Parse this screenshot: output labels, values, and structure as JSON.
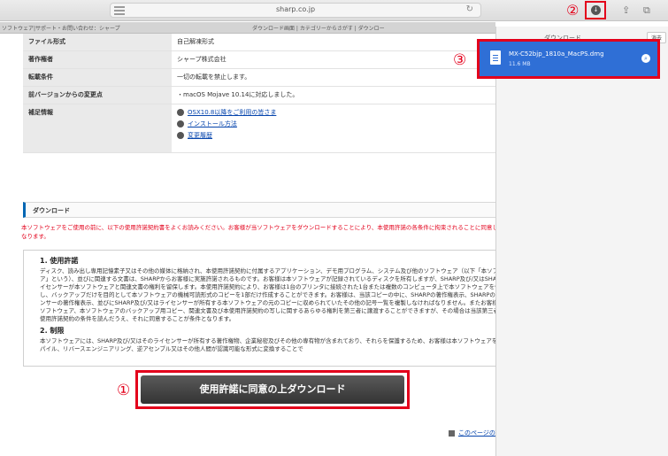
{
  "browser": {
    "address": "sharp.co.jp",
    "tab_left": "ソフトウェア|サポート・お問い合わせ：シャープ",
    "tab_right": "ダウンロード画面 | カテゴリーからさがす | ダウンロー",
    "reload_glyph": "↻",
    "share_glyph": "⇪",
    "tabs_glyph": "⧉"
  },
  "markers": {
    "one": "①",
    "two": "②",
    "three": "③"
  },
  "info": {
    "rows": [
      {
        "label": "ファイル形式",
        "value": "自己解凍形式"
      },
      {
        "label": "著作権者",
        "value": "シャープ株式会社"
      },
      {
        "label": "転載条件",
        "value": "一切の転載を禁止します。"
      },
      {
        "label": "前バージョンからの変更点",
        "value": "・macOS Mojave 10.14に対応しました。"
      }
    ],
    "supplement_label": "補足情報",
    "supplement_links": [
      "OSX10.8以降をご利用の皆さま",
      "インストール方法",
      "変更履歴"
    ]
  },
  "download_section": {
    "heading": "ダウンロード",
    "warning": "本ソフトウェアをご使用の前に、以下の使用許諾契約書をよくお読みください。お客様が当ソフトウェアをダウンロードすることにより、本使用許諾の各条件に拘束されることに同意したことになります。"
  },
  "license": {
    "h1": "1. 使用許諾",
    "p1": "ディスク、読み出し専用記憶素子又はその他の媒体に格納され、本使用許諾契約に付属するアプリケーション、デモ用プログラム、システム及び他のソフトウェア（以下「本ソフトウェア」という）、並びに関連する文書は、SHARPからお客様に実施許諾されるものです。お客様は本ソフトウェアが記録されているディスクを所有しますが、SHARP及び/又はSHARPのライセンサーが本ソフトウェアと関連文書の権利を留保します。本使用許諾契約により、お客様は1台のプリンタに接続された1台または複数のコンピュータ上で本ソフトウェアを使用し、バックアップだけを目的として本ソフトウェアの機械可読形式のコピーを1部だけ作成することができます。お客様は、当該コピーの中に、SHARPの著作権表示、SHARPのライセンサーの著作権表示、並びにSHARP及び/又はライセンサーが所有する本ソフトウェアの元のコピーに収められていたその他の記号一覧を複製しなければなりません。またお客様は、本ソフトウェア、本ソフトウェアのバックアップ用コピー、関連文書及び本使用許諾契約の写しに関するあらゆる権利を第三者に譲渡することができますが、その場合は当該第三者が本使用許諾契約の条件を読んだうえ、それに同意することが条件となります。",
    "h2": "2. 制限",
    "p2": "本ソフトウェアには、SHARP及び/又はそのライセンサーが所有する著作権物、企業秘密及びその他の専有物が含まれており、それらを保護するため、お客様は本ソフトウェアを逆コンパイル、リバースエンジニアリング、逆アセンブル又はその他人間が認識可能な形式に変換することで"
  },
  "agree_button": "使用許諾に同意の上ダウンロード",
  "top_link": "このページのTOPへ",
  "downloads_panel": {
    "title": "ダウンロード",
    "clear": "消去",
    "file_name": "MX-C52bjp_1810a_MacPS.dmg",
    "file_size": "11.6 MB"
  },
  "colors": {
    "highlight": "#e3001b",
    "selection": "#2f6fd6",
    "link": "#0645ad"
  }
}
